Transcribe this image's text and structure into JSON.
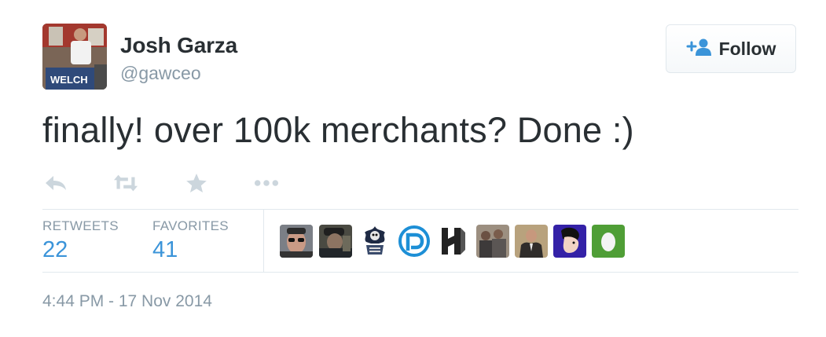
{
  "user": {
    "name": "Josh Garza",
    "handle": "@gawceo",
    "avatar_sign_text": "WELCH"
  },
  "follow_button": {
    "label": "Follow",
    "icon": "add-user-icon"
  },
  "tweet": {
    "text": "finally! over 100k merchants? Done :)"
  },
  "actions": [
    {
      "name": "reply",
      "icon": "reply-icon"
    },
    {
      "name": "retweet",
      "icon": "retweet-icon"
    },
    {
      "name": "favorite",
      "icon": "star-icon"
    },
    {
      "name": "more",
      "icon": "more-icon"
    }
  ],
  "stats": {
    "retweets": {
      "label": "RETWEETS",
      "count": "22"
    },
    "favorites": {
      "label": "FAVORITES",
      "count": "41"
    }
  },
  "favorited_by": [
    {
      "icon": "user-avatar-sunglasses"
    },
    {
      "icon": "user-avatar-cap"
    },
    {
      "icon": "user-avatar-skeleton"
    },
    {
      "icon": "user-avatar-blue-logo"
    },
    {
      "icon": "user-avatar-h-logo"
    },
    {
      "icon": "user-avatar-group"
    },
    {
      "icon": "user-avatar-suit"
    },
    {
      "icon": "user-avatar-cartoon"
    },
    {
      "icon": "user-avatar-egg"
    }
  ],
  "timestamp": "4:44 PM - 17 Nov 2014",
  "colors": {
    "link_blue": "#3b94d9",
    "muted_gray": "#8899a6",
    "text": "#292f33",
    "action_icon": "#ccd6dd",
    "border": "#e1e8ed"
  }
}
